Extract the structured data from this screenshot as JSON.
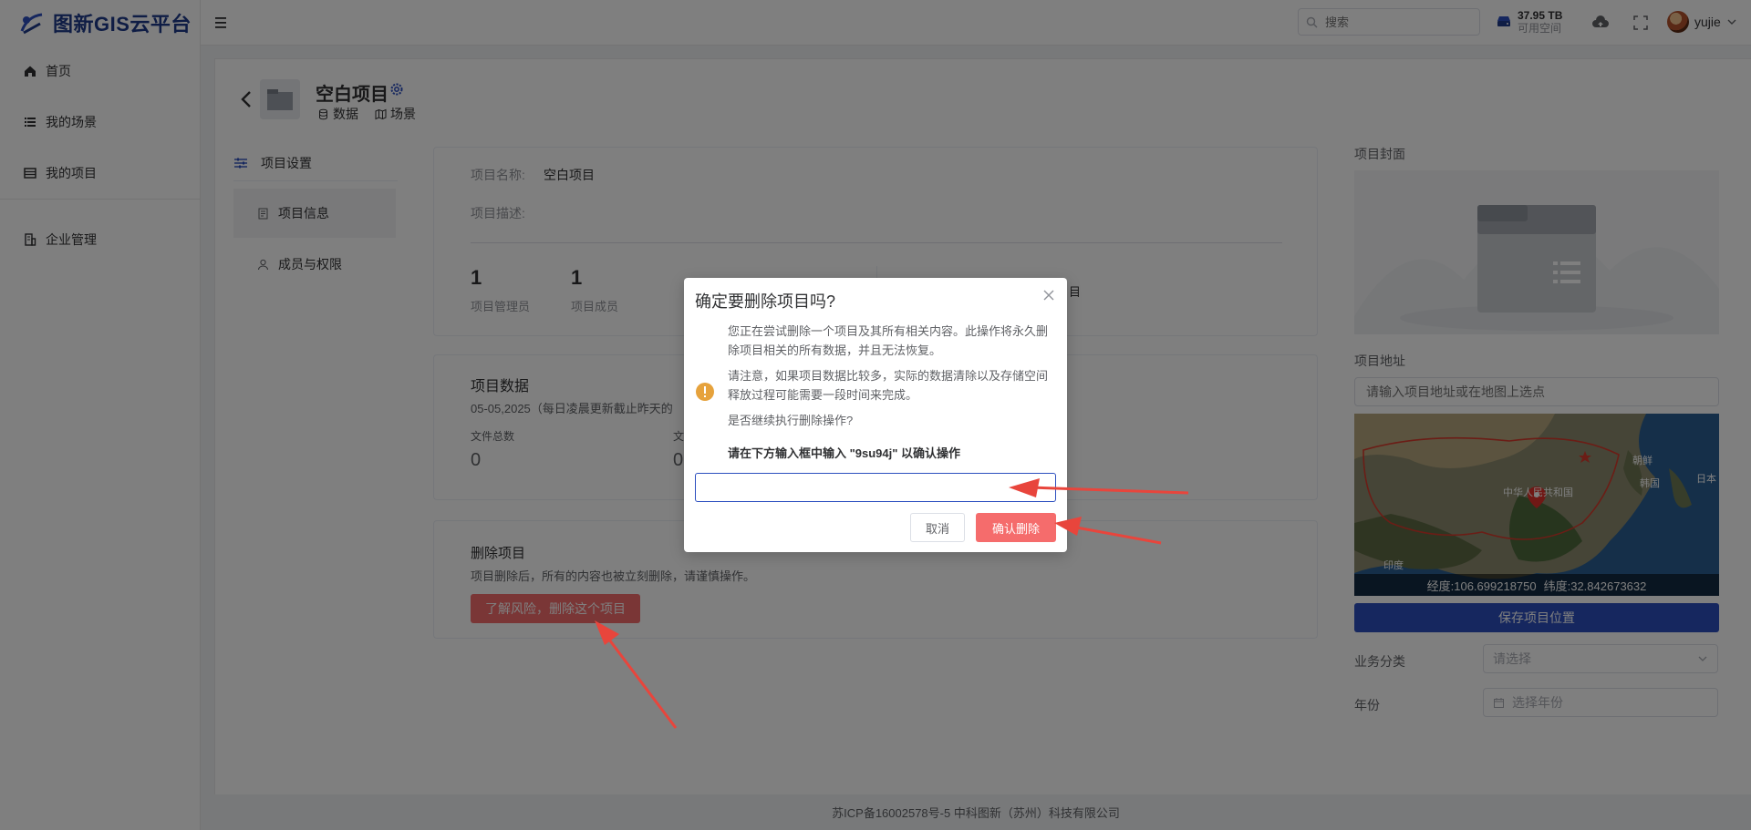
{
  "brand": {
    "name": "图新GIS云平台"
  },
  "sidebar": {
    "items": [
      {
        "label": "首页",
        "icon": "home-icon"
      },
      {
        "label": "我的场景",
        "icon": "list-icon"
      },
      {
        "label": "我的项目",
        "icon": "project-list-icon"
      },
      {
        "label": "企业管理",
        "icon": "building-icon"
      }
    ]
  },
  "header": {
    "search_placeholder": "搜索",
    "storage_value": "37.95 TB",
    "storage_label": "可用空间",
    "username": "yujie"
  },
  "project": {
    "title": "空白项目",
    "links": {
      "data": "数据",
      "scene": "场景"
    }
  },
  "settings_menu": {
    "heading": "项目设置",
    "items": [
      "项目信息",
      "成员与权限"
    ]
  },
  "info_panel": {
    "name_label": "项目名称:",
    "name_value": "空白项目",
    "desc_label": "项目描述:",
    "admins_count": "1",
    "admins_label": "项目管理员",
    "members_count": "1",
    "members_label": "项目成员",
    "partial_label": "目"
  },
  "data_panel": {
    "title": "项目数据",
    "update_note": "05-05,2025（每日凌晨更新截止昨天的",
    "file_total_label": "文件总数",
    "file_total_value": "0",
    "second_label": "文",
    "second_value": "0"
  },
  "delete_panel": {
    "title": "删除项目",
    "description": "项目删除后，所有的内容也被立刻删除，请谨慎操作。",
    "button_label": "了解风险，删除这个项目"
  },
  "right_column": {
    "cover_label": "项目封面",
    "address_label": "项目地址",
    "address_placeholder": "请输入项目地址或在地图上选点",
    "map_labels": {
      "country": "中华人民共和国",
      "korea": "朝鲜",
      "south_korea": "韩国",
      "japan": "日本",
      "india": "印度"
    },
    "longitude": "经度:106.699218750",
    "latitude": "纬度:32.842673632",
    "save_button": "保存项目位置",
    "category_label": "业务分类",
    "category_placeholder": "请选择",
    "year_label": "年份",
    "year_placeholder": "选择年份"
  },
  "footer": {
    "text": "苏ICP备16002578号-5 中科图新（苏州）科技有限公司"
  },
  "dialog": {
    "title": "确定要删除项目吗?",
    "p1": "您正在尝试删除一个项目及其所有相关内容。此操作将永久删除项目相关的所有数据，并且无法恢复。",
    "p2": "请注意，如果项目数据比较多，实际的数据清除以及存储空间释放过程可能需要一段时间来完成。",
    "p3": "是否继续执行删除操作?",
    "hint": "请在下方输入框中输入 \"9su94j\" 以确认操作",
    "input_value": "",
    "cancel_label": "取消",
    "confirm_label": "确认删除"
  },
  "colors": {
    "brand": "#1e3a8a",
    "primary": "#2c4fbf",
    "danger": "#f56c6c",
    "warning": "#e6a23c",
    "annotation": "#e8453c"
  }
}
